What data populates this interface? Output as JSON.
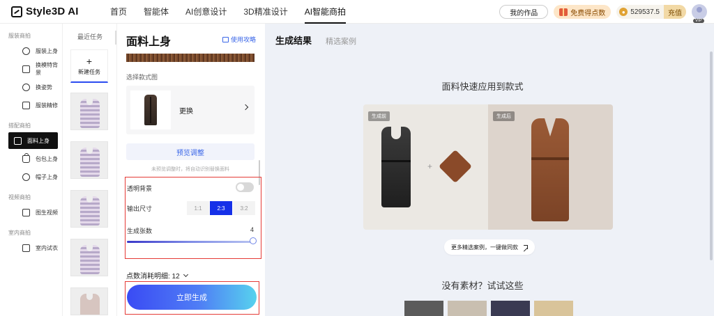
{
  "header": {
    "logo": "Style3D AI",
    "nav": [
      {
        "label": "首页"
      },
      {
        "label": "智能体"
      },
      {
        "label": "AI创意设计"
      },
      {
        "label": "3D精准设计"
      },
      {
        "label": "AI智能商拍",
        "active": true
      }
    ],
    "my_works": "我的作品",
    "free_points": "免费得点数",
    "points_value": "529537.5",
    "recharge": "充值",
    "vip": "VIP"
  },
  "sidebar": {
    "groups": [
      {
        "title": "服装商拍",
        "items": [
          {
            "label": "服装上身",
            "icon": "shirt-icon"
          },
          {
            "label": "换模特背景",
            "icon": "scan-icon"
          },
          {
            "label": "换姿势",
            "icon": "pose-icon"
          },
          {
            "label": "服装精修",
            "icon": "refine-icon"
          }
        ]
      },
      {
        "title": "搭配商拍",
        "items": [
          {
            "label": "面料上身",
            "icon": "fabric-icon",
            "active": true
          },
          {
            "label": "包包上身",
            "icon": "bag-icon"
          },
          {
            "label": "帽子上身",
            "icon": "hat-icon"
          }
        ]
      },
      {
        "title": "视频商拍",
        "items": [
          {
            "label": "图生视频",
            "icon": "video-icon"
          }
        ]
      },
      {
        "title": "室内商拍",
        "items": [
          {
            "label": "室内试衣",
            "icon": "fitting-icon"
          }
        ]
      }
    ]
  },
  "tasks": {
    "title": "最近任务",
    "new_task": "新建任务"
  },
  "panel": {
    "title": "面料上身",
    "guide": "使用攻略",
    "select_style_label": "选择款式图",
    "change_label": "更换",
    "preview_button": "预览调整",
    "hint": "未预览调整时，将自动识别替换面料",
    "transparent_bg_label": "透明背景",
    "transparent_bg_on": false,
    "output_size_label": "输出尺寸",
    "output_sizes": [
      "1:1",
      "2:3",
      "3:2"
    ],
    "output_size_selected": "2:3",
    "count_label": "生成张数",
    "count_value": "4",
    "cost_label": "点数消耗明细: 12",
    "generate_button": "立即生成"
  },
  "main": {
    "tabs": [
      {
        "label": "生成结果",
        "active": true
      },
      {
        "label": "精选案例"
      }
    ],
    "demo_title": "面料快速应用到款式",
    "before_tag": "生成前",
    "after_tag": "生成后",
    "more_cases": "更多精选案例，一键做同款",
    "no_material_title": "没有素材？试试这些",
    "material_colors": [
      "#5b5b5b",
      "#c9bfb0",
      "#3a3a52",
      "#d9c49a"
    ]
  }
}
